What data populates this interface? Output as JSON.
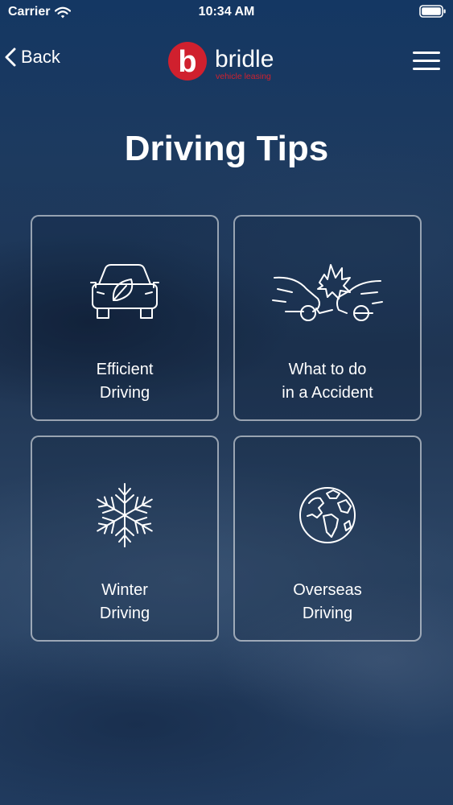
{
  "status_bar": {
    "carrier": "Carrier",
    "time": "10:34 AM"
  },
  "nav": {
    "back_label": "Back"
  },
  "logo": {
    "brand": "bridle",
    "tagline": "vehicle leasing",
    "letter": "b"
  },
  "title": "Driving Tips",
  "tiles": [
    {
      "line1": "Efficient",
      "line2": "Driving",
      "icon": "eco-car-icon"
    },
    {
      "line1": "What to do",
      "line2": "in a Accident",
      "icon": "car-crash-icon"
    },
    {
      "line1": "Winter",
      "line2": "Driving",
      "icon": "snowflake-icon"
    },
    {
      "line1": "Overseas",
      "line2": "Driving",
      "icon": "globe-icon"
    }
  ],
  "colors": {
    "brand_red": "#d0202e",
    "brand_white": "#ffffff"
  }
}
